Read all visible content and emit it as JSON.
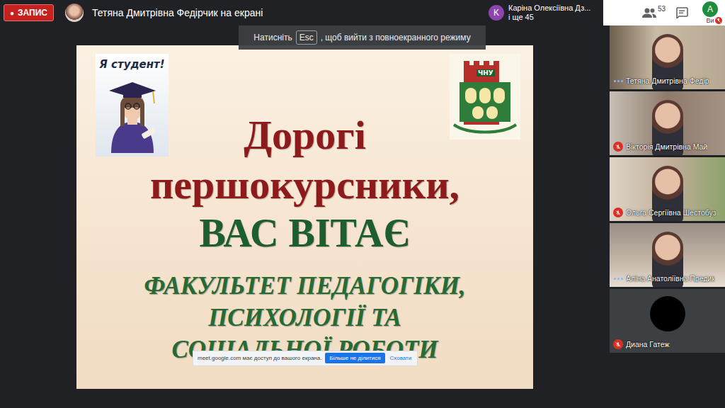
{
  "recording": {
    "icon": "●",
    "label": "ЗАПИС"
  },
  "presenter": "Тетяна Дмитрівна Федірчик на екрані",
  "participants_summary": {
    "avatar": "K",
    "name": "Каріна Олексіївна Дз...",
    "more": "і ще 45"
  },
  "toolbar": {
    "people_count": "53",
    "self_avatar": "A",
    "self_label": "Ви",
    "self_muted": true
  },
  "fullscreen_hint": {
    "before": "Натисніть",
    "key": "Esc",
    "after": ", щоб вийти з повноекранного режиму"
  },
  "slide": {
    "badge": "Я студент!",
    "logo_text": "ЧНУ",
    "lines": [
      {
        "text": "Дорогі",
        "kind": "greeting"
      },
      {
        "text": "першокурсники,",
        "kind": "greeting"
      },
      {
        "text": "ВАС ВІТАЄ",
        "kind": "headline"
      },
      {
        "text": "ФАКУЛЬТЕТ ПЕДАГОГІКИ,",
        "kind": "faculty"
      },
      {
        "text": "ПСИХОЛОГІЇ ТА",
        "kind": "faculty"
      },
      {
        "text": "СОЦІАЛЬНОЇ РОБОТИ",
        "kind": "faculty"
      }
    ]
  },
  "share_banner": {
    "message": "meet.google.com має доступ до вашого екрана.",
    "stop": "Більше не ділитися",
    "hide": "Сховати"
  },
  "tiles": [
    {
      "name": "Тетяна Дмитрівна Федір",
      "muted": false,
      "kind": "video"
    },
    {
      "name": "Вікторія Дмитрівна Май",
      "muted": true,
      "kind": "video"
    },
    {
      "name": "Ольга Сергіївна Шестобуз",
      "muted": true,
      "kind": "video"
    },
    {
      "name": "Аліна Анатоліївна Предик",
      "muted": false,
      "kind": "video"
    },
    {
      "name": "Диана Гатеж",
      "muted": true,
      "kind": "avatar"
    }
  ]
}
